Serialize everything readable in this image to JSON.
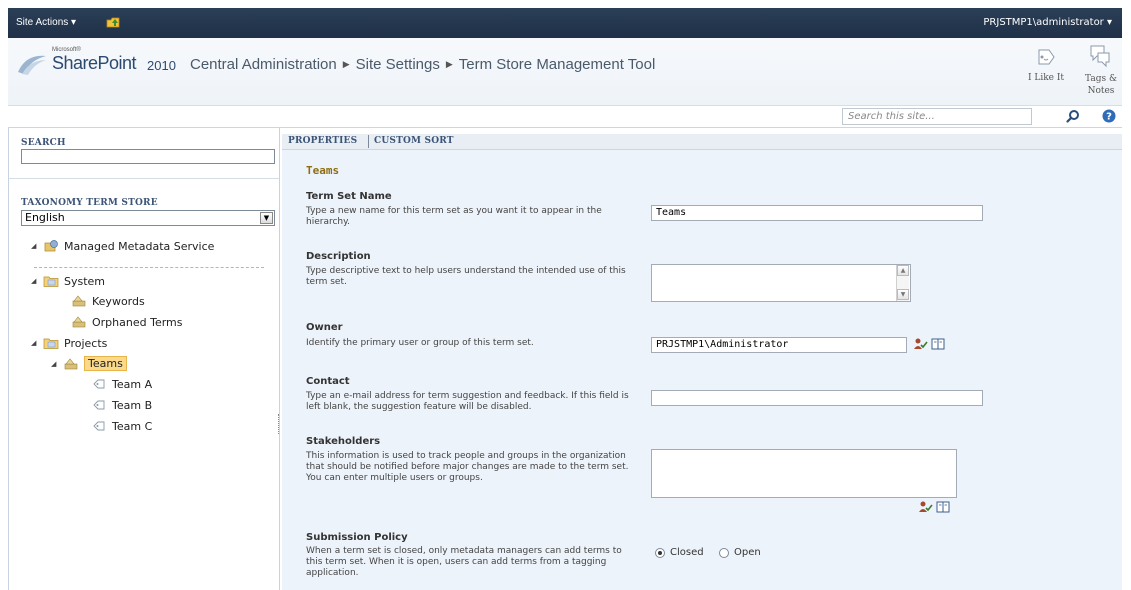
{
  "ribbon": {
    "site_actions": "Site Actions ▾",
    "user": "PRJSTMP1\\administrator ▾"
  },
  "header": {
    "logo_ms": "Microsoft®",
    "logo_product": "SharePoint",
    "logo_year": "2010",
    "breadcrumb": [
      "Central Administration",
      "Site Settings",
      "Term Store Management Tool"
    ],
    "like_label": "I Like It",
    "tags_label_1": "Tags &",
    "tags_label_2": "Notes"
  },
  "site_search": {
    "placeholder": "Search this site..."
  },
  "left": {
    "search_header": "SEARCH",
    "search_value": "",
    "taxonomy_header": "TAXONOMY TERM STORE",
    "language": "English",
    "tree": {
      "root": "Managed Metadata Service",
      "system": "System",
      "keywords": "Keywords",
      "orphaned": "Orphaned Terms",
      "projects": "Projects",
      "teams": "Teams",
      "team_a": "Team A",
      "team_b": "Team B",
      "team_c": "Team C"
    }
  },
  "tabs": {
    "properties": "PROPERTIES",
    "custom_sort": "CUSTOM SORT"
  },
  "properties": {
    "title": "Teams",
    "term_set_name": {
      "label": "Term Set Name",
      "desc": "Type a new name for this term set as you want it to appear in the hierarchy.",
      "value": "Teams"
    },
    "description": {
      "label": "Description",
      "desc": "Type descriptive text to help users understand the intended use of this term set.",
      "value": ""
    },
    "owner": {
      "label": "Owner",
      "desc": "Identify the primary user or group of this term set.",
      "value": "PRJSTMP1\\Administrator"
    },
    "contact": {
      "label": "Contact",
      "desc": "Type an e-mail address for term suggestion and feedback. If this field is left blank, the suggestion feature will be disabled.",
      "value": ""
    },
    "stakeholders": {
      "label": "Stakeholders",
      "desc": "This information is used to track people and groups in the organization that should be notified before major changes are made to the term set. You can enter multiple users or groups.",
      "value": ""
    },
    "submission": {
      "label": "Submission Policy",
      "desc": "When a term set is closed, only metadata managers can add terms to this term set. When it is open, users can add terms from a tagging application.",
      "closed": "Closed",
      "open": "Open",
      "selected": "closed"
    }
  }
}
